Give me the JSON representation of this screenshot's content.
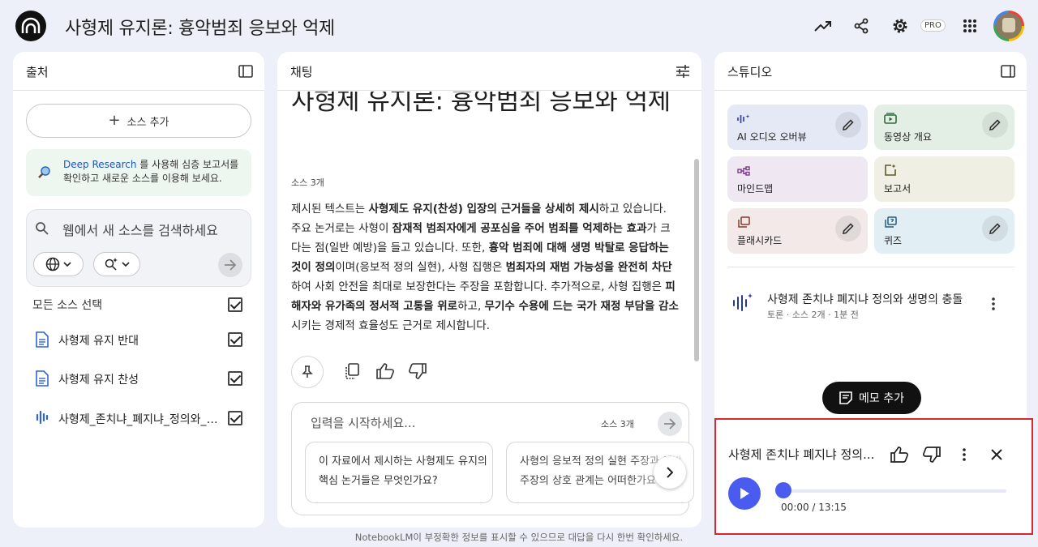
{
  "app": {
    "title": "사형제 유지론: 흉악범죄 응보와 억제",
    "pro_badge": "PRO",
    "footer": "NotebookLM이 부정확한 정보를 표시할 수 있으므로 대답을 다시 한번 확인하세요."
  },
  "sources": {
    "title": "출처",
    "add_label": "소스 추가",
    "deep_research_link": "Deep Research",
    "deep_research_text": " 를 사용해 심층 보고서를 확인하고 새로운 소스를 이용해 보세요.",
    "search_placeholder": "웹에서 새 소스를 검색하세요",
    "select_all": "모든 소스 선택",
    "items": [
      {
        "label": "사형제 유지 반대",
        "icon": "document-icon"
      },
      {
        "label": "사형제 유지 찬성",
        "icon": "document-icon"
      },
      {
        "label": "사형제_존치냐_폐지냐_정의와_생명의_충돌",
        "icon": "audio-icon"
      }
    ]
  },
  "chat": {
    "title": "채팅",
    "note_title": "사형제 유지론: 흉악범죄 응보와 억제",
    "source_count": "소스 3개",
    "input_placeholder": "입력을 시작하세요...",
    "input_source_count": "소스 3개",
    "suggestions": [
      "이 자료에서 제시하는 사형제도 유지의 핵심 논거들은 무엇인가요?",
      "사형의 응보적 정의 실현 주장과 예방 주장의 상호 관계는 어떠한가요?"
    ]
  },
  "studio": {
    "title": "스튜디오",
    "tiles": [
      {
        "label": "AI 오디오 오버뷰",
        "icon": "audio-wave-icon",
        "color": "#e5e9f6"
      },
      {
        "label": "동영상 개요",
        "icon": "video-icon",
        "color": "#e3efe5"
      },
      {
        "label": "마인드맵",
        "icon": "mindmap-icon",
        "color": "#efe8f3"
      },
      {
        "label": "보고서",
        "icon": "report-icon",
        "color": "#efefe3"
      },
      {
        "label": "플래시카드",
        "icon": "flashcard-icon",
        "color": "#f3e9e9"
      },
      {
        "label": "퀴즈",
        "icon": "quiz-icon",
        "color": "#e1eef4"
      }
    ],
    "note_title": "사형제 존치냐 폐지냐 정의와 생명의 충돌",
    "note_sub": "토론 · 소스 2개 · 1분 전",
    "memo_button": "메모 추가"
  },
  "player": {
    "title": "사형제 존치냐 폐지냐 정의...",
    "time": "00:00 / 13:15",
    "progress": 0,
    "accent": "#4a5cf0"
  },
  "colors": {
    "background": "#eef0f9",
    "highlight_border": "#d9272e"
  }
}
